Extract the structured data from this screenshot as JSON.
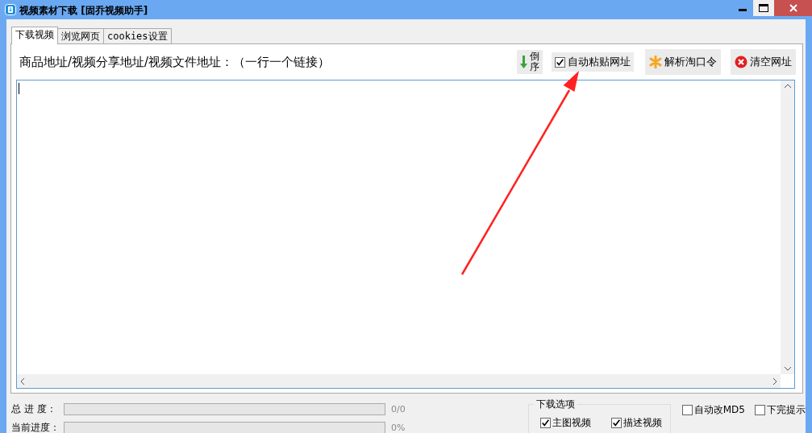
{
  "window": {
    "title": "视频素材下载 [固乔视频助手]"
  },
  "tabs": [
    {
      "label": "下载视频",
      "selected": true
    },
    {
      "label": "浏览网页",
      "selected": false
    },
    {
      "label": "cookies设置",
      "selected": false
    }
  ],
  "url_panel": {
    "label": "商品地址/视频分享地址/视频文件地址：（一行一个链接）",
    "reverse_button": "倒序",
    "auto_paste": {
      "label": "自动粘贴网址",
      "checked": true
    },
    "buttons": [
      {
        "label": "解析淘口令",
        "kind": "parse"
      },
      {
        "label": "清空网址",
        "kind": "clear"
      }
    ]
  },
  "progress": [
    {
      "label": "总 进 度：",
      "level": 0,
      "reading": "0/0"
    },
    {
      "label": "当前进度：",
      "level": 0,
      "reading": "0%"
    }
  ],
  "download_options": {
    "title": "下载选项",
    "options": [
      {
        "label": "主图视频",
        "checked": true
      },
      {
        "label": "描述视频",
        "checked": true
      }
    ]
  },
  "extra_options": [
    {
      "label": "自动改MD5",
      "checked": false
    },
    {
      "label": "下完提示",
      "checked": false
    }
  ]
}
